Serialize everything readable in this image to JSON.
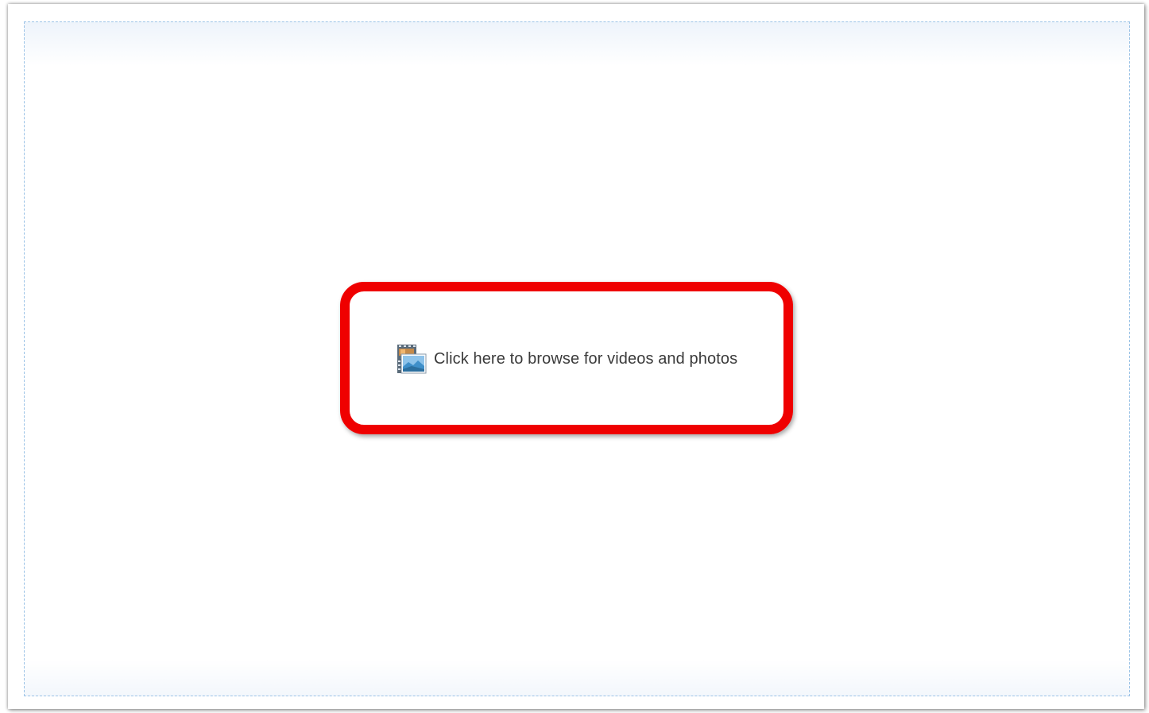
{
  "drop_area": {
    "browse_label": "Click here to browse for videos and photos",
    "browse_icon": "film-photo-icon"
  },
  "colors": {
    "highlight": "#ef0000",
    "dashed_border": "#9cc3e6",
    "text": "#3a3a3a"
  }
}
